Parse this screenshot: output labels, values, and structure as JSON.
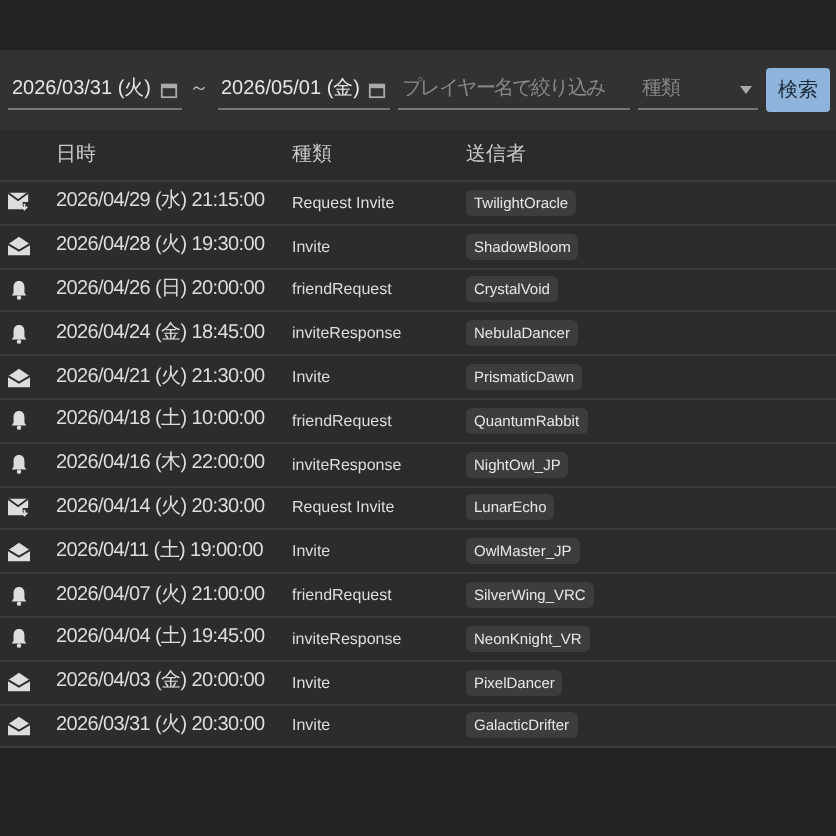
{
  "filters": {
    "date_from": "2026/03/31 (火)",
    "separator": "～",
    "date_to": "2026/05/01 (金)",
    "player": {
      "placeholder": "プレイヤー名で絞り込み"
    },
    "type": {
      "placeholder": "種類"
    },
    "search_button": "検索"
  },
  "table": {
    "columns": [
      "日時",
      "種類",
      "送信者"
    ],
    "rows": [
      {
        "kind": "request",
        "datetime": "2026/04/29 (水) 21:15:00",
        "type": "Request Invite",
        "sender": "TwilightOracle"
      },
      {
        "kind": "invite",
        "datetime": "2026/04/28 (火) 19:30:00",
        "type": "Invite",
        "sender": "ShadowBloom"
      },
      {
        "kind": "notice",
        "datetime": "2026/04/26 (日) 20:00:00",
        "type": "friendRequest",
        "sender": "CrystalVoid"
      },
      {
        "kind": "notice",
        "datetime": "2026/04/24 (金) 18:45:00",
        "type": "inviteResponse",
        "sender": "NebulaDancer"
      },
      {
        "kind": "invite",
        "datetime": "2026/04/21 (火) 21:30:00",
        "type": "Invite",
        "sender": "PrismaticDawn"
      },
      {
        "kind": "notice",
        "datetime": "2026/04/18 (土) 10:00:00",
        "type": "friendRequest",
        "sender": "QuantumRabbit"
      },
      {
        "kind": "notice",
        "datetime": "2026/04/16 (木) 22:00:00",
        "type": "inviteResponse",
        "sender": "NightOwl_JP"
      },
      {
        "kind": "request",
        "datetime": "2026/04/14 (火) 20:30:00",
        "type": "Request Invite",
        "sender": "LunarEcho"
      },
      {
        "kind": "invite",
        "datetime": "2026/04/11 (土) 19:00:00",
        "type": "Invite",
        "sender": "OwlMaster_JP"
      },
      {
        "kind": "notice",
        "datetime": "2026/04/07 (火) 21:00:00",
        "type": "friendRequest",
        "sender": "SilverWing_VRC"
      },
      {
        "kind": "notice",
        "datetime": "2026/04/04 (土) 19:45:00",
        "type": "inviteResponse",
        "sender": "NeonKnight_VR"
      },
      {
        "kind": "invite",
        "datetime": "2026/04/03 (金) 20:00:00",
        "type": "Invite",
        "sender": "PixelDancer"
      },
      {
        "kind": "invite",
        "datetime": "2026/03/31 (火) 20:30:00",
        "type": "Invite",
        "sender": "GalacticDrifter"
      }
    ]
  }
}
